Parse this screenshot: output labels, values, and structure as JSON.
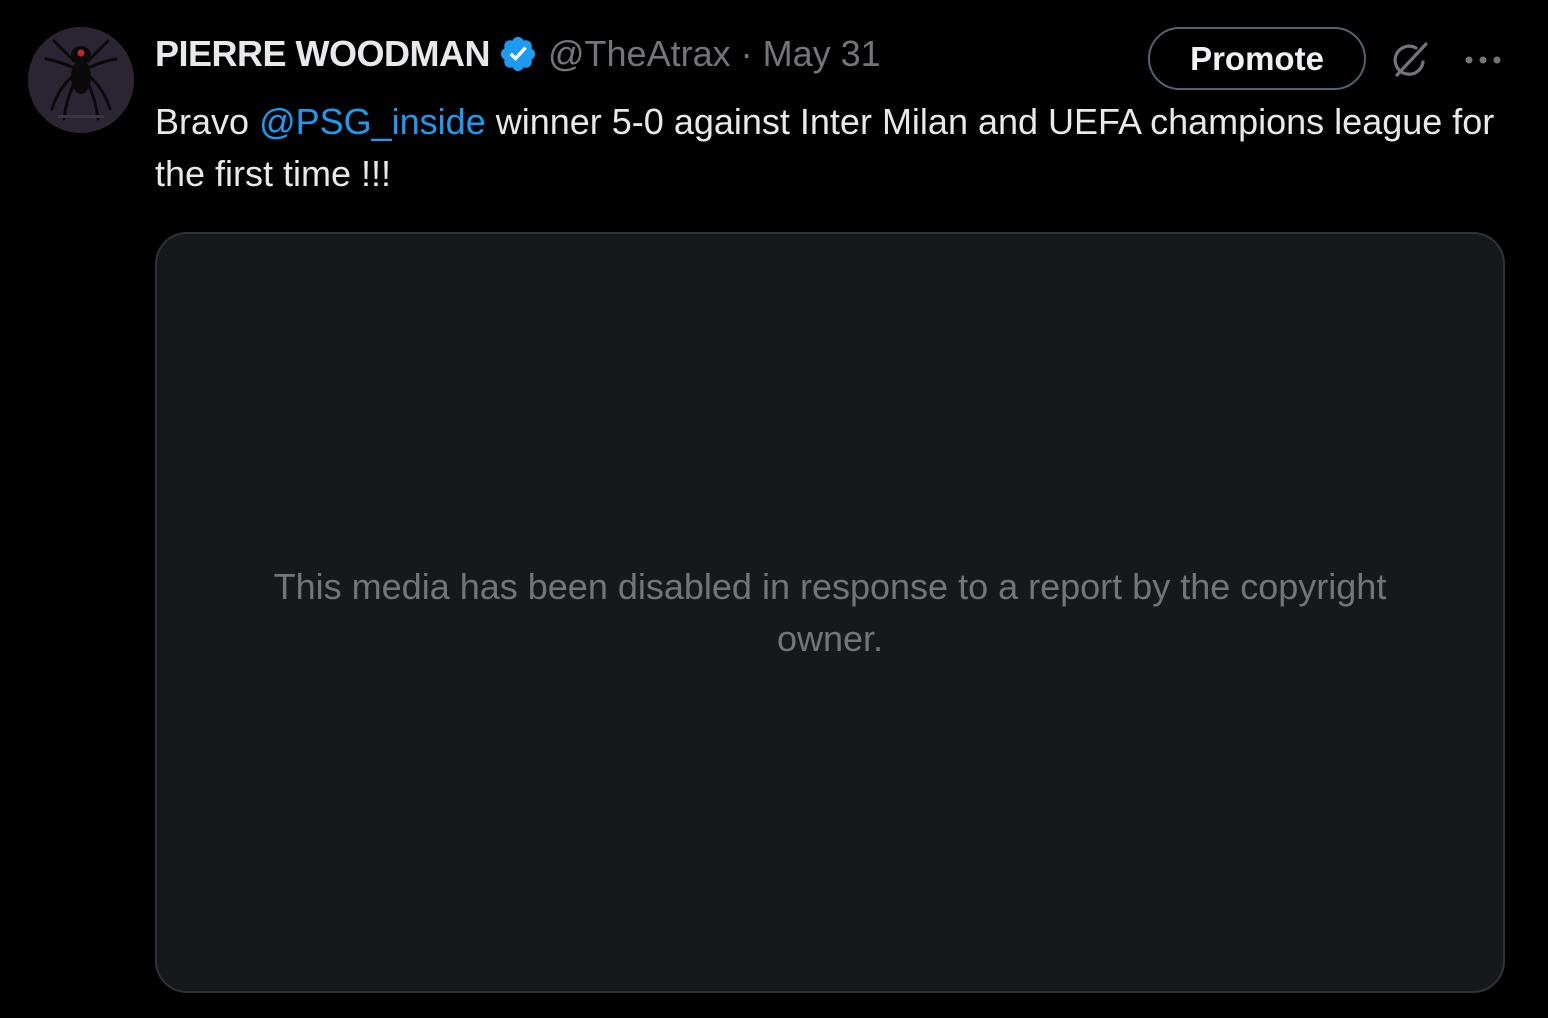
{
  "tweet": {
    "author": {
      "display_name": "PIERRE WOODMAN",
      "verified": true,
      "handle": "@TheAtrax",
      "avatar_icon": "spider-logo-icon"
    },
    "separator": "·",
    "date": "May 31",
    "promote_label": "Promote",
    "text_prefix": "Bravo",
    "mention": "@PSG_inside",
    "text_suffix": "winner 5-0 against Inter Milan and UEFA champions league for the first time !!!",
    "media_notice": "This media has been disabled in response to a report by the copyright owner."
  },
  "colors": {
    "background": "#000000",
    "text_primary": "#e7e9ea",
    "text_secondary": "#71767b",
    "accent": "#1d9bf0",
    "media_bg": "#17181c",
    "border": "#2f3336"
  },
  "icons": {
    "verified": "verified-badge-icon",
    "grok": "grok-icon",
    "more": "more-options-icon"
  }
}
